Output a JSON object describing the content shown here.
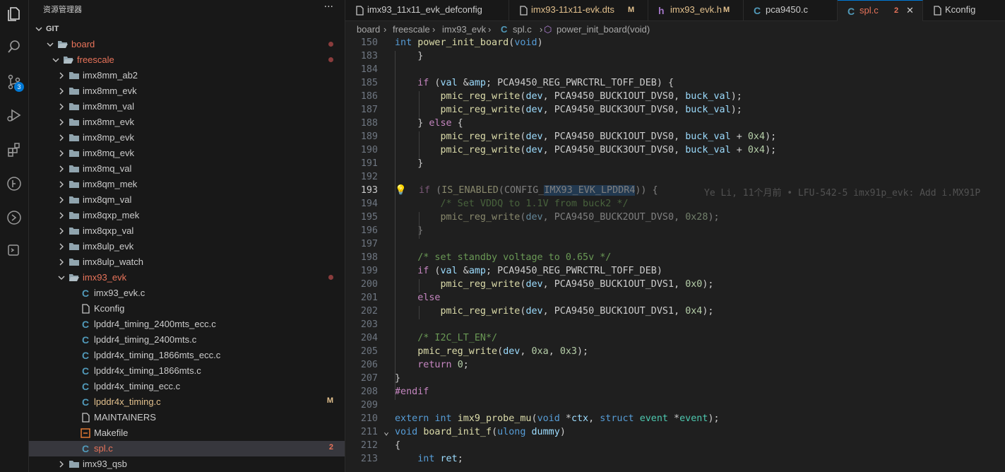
{
  "activity_bar": {
    "scm_badge": "3",
    "icons": [
      "explorer-icon",
      "search-icon",
      "source-control-icon",
      "run-debug-icon",
      "extensions-icon",
      "git-graph-icon",
      "remote-explorer-icon",
      "test-icon"
    ]
  },
  "sidebar": {
    "title": "资源管理器",
    "more": "···",
    "tree": [
      {
        "label": "GIT",
        "depth": 0,
        "kind": "root",
        "chevron": "down"
      },
      {
        "label": "board",
        "depth": 1,
        "kind": "folder",
        "chevron": "down",
        "status": "dot",
        "color": "#e8735a"
      },
      {
        "label": "freescale",
        "depth": 2,
        "kind": "folder",
        "chevron": "down",
        "status": "dot",
        "color": "#e8735a"
      },
      {
        "label": "imx8mm_ab2",
        "depth": 3,
        "kind": "folder",
        "chevron": "right"
      },
      {
        "label": "imx8mm_evk",
        "depth": 3,
        "kind": "folder",
        "chevron": "right"
      },
      {
        "label": "imx8mm_val",
        "depth": 3,
        "kind": "folder",
        "chevron": "right"
      },
      {
        "label": "imx8mn_evk",
        "depth": 3,
        "kind": "folder",
        "chevron": "right"
      },
      {
        "label": "imx8mp_evk",
        "depth": 3,
        "kind": "folder",
        "chevron": "right"
      },
      {
        "label": "imx8mq_evk",
        "depth": 3,
        "kind": "folder",
        "chevron": "right"
      },
      {
        "label": "imx8mq_val",
        "depth": 3,
        "kind": "folder",
        "chevron": "right"
      },
      {
        "label": "imx8qm_mek",
        "depth": 3,
        "kind": "folder",
        "chevron": "right"
      },
      {
        "label": "imx8qm_val",
        "depth": 3,
        "kind": "folder",
        "chevron": "right"
      },
      {
        "label": "imx8qxp_mek",
        "depth": 3,
        "kind": "folder",
        "chevron": "right"
      },
      {
        "label": "imx8qxp_val",
        "depth": 3,
        "kind": "folder",
        "chevron": "right"
      },
      {
        "label": "imx8ulp_evk",
        "depth": 3,
        "kind": "folder",
        "chevron": "right"
      },
      {
        "label": "imx8ulp_watch",
        "depth": 3,
        "kind": "folder",
        "chevron": "right"
      },
      {
        "label": "imx93_evk",
        "depth": 3,
        "kind": "folder",
        "chevron": "down",
        "status": "dot",
        "color": "#e8735a"
      },
      {
        "label": "imx93_evk.c",
        "depth": 4,
        "kind": "c"
      },
      {
        "label": "Kconfig",
        "depth": 4,
        "kind": "file"
      },
      {
        "label": "lpddr4_timing_2400mts_ecc.c",
        "depth": 4,
        "kind": "c"
      },
      {
        "label": "lpddr4_timing_2400mts.c",
        "depth": 4,
        "kind": "c"
      },
      {
        "label": "lpddr4x_timing_1866mts_ecc.c",
        "depth": 4,
        "kind": "c"
      },
      {
        "label": "lpddr4x_timing_1866mts.c",
        "depth": 4,
        "kind": "c"
      },
      {
        "label": "lpddr4x_timing_ecc.c",
        "depth": 4,
        "kind": "c"
      },
      {
        "label": "lpddr4x_timing.c",
        "depth": 4,
        "kind": "c",
        "status": "M",
        "color": "#e2c08d"
      },
      {
        "label": "MAINTAINERS",
        "depth": 4,
        "kind": "file"
      },
      {
        "label": "Makefile",
        "depth": 4,
        "kind": "make"
      },
      {
        "label": "spl.c",
        "depth": 4,
        "kind": "c",
        "status": "2",
        "color": "#e8735a",
        "selected": true
      },
      {
        "label": "imx93_qsb",
        "depth": 3,
        "kind": "folder",
        "chevron": "right"
      }
    ]
  },
  "tabs": [
    {
      "label": "imx93_11x11_evk_defconfig",
      "icon": "config-file-icon",
      "color": "#cccccc"
    },
    {
      "label": "imx93-11x11-evk.dts",
      "icon": "dts-file-icon",
      "status": "M",
      "color": "#e2c08d"
    },
    {
      "label": "imx93_evk.h",
      "icon": "h-file-icon",
      "status": "M",
      "color": "#e2c08d"
    },
    {
      "label": "pca9450.c",
      "icon": "c-file-icon",
      "color": "#cccccc"
    },
    {
      "label": "spl.c",
      "icon": "c-file-icon",
      "status": "2",
      "close": "✕",
      "color": "#e8735a",
      "active": true
    },
    {
      "label": "Kconfig",
      "icon": "config-file-icon",
      "color": "#cccccc"
    }
  ],
  "breadcrumbs": [
    "board",
    "freescale",
    "imx93_evk",
    "spl.c",
    "power_init_board(void)"
  ],
  "blame": "Ye Li, 11个月前 • LFU-542-5 imx91p_evk: Add i.MX91P",
  "code": [
    {
      "n": "150",
      "t": "int power_init_board(void)"
    },
    {
      "n": "183",
      "t": "    }"
    },
    {
      "n": "184",
      "t": ""
    },
    {
      "n": "185",
      "t": "    if (val & PCA9450_REG_PWRCTRL_TOFF_DEB) {"
    },
    {
      "n": "186",
      "t": "        pmic_reg_write(dev, PCA9450_BUCK1OUT_DVS0, buck_val);"
    },
    {
      "n": "187",
      "t": "        pmic_reg_write(dev, PCA9450_BUCK3OUT_DVS0, buck_val);"
    },
    {
      "n": "188",
      "t": "    } else {"
    },
    {
      "n": "189",
      "t": "        pmic_reg_write(dev, PCA9450_BUCK1OUT_DVS0, buck_val + 0x4);"
    },
    {
      "n": "190",
      "t": "        pmic_reg_write(dev, PCA9450_BUCK3OUT_DVS0, buck_val + 0x4);"
    },
    {
      "n": "191",
      "t": "    }"
    },
    {
      "n": "192",
      "t": ""
    },
    {
      "n": "193",
      "t": "    if (IS_ENABLED(CONFIG_IMX93_EVK_LPDDR4)) {"
    },
    {
      "n": "194",
      "t": "        /* Set VDDQ to 1.1V from buck2 */"
    },
    {
      "n": "195",
      "t": "        pmic_reg_write(dev, PCA9450_BUCK2OUT_DVS0, 0x28);"
    },
    {
      "n": "196",
      "t": "    }"
    },
    {
      "n": "197",
      "t": ""
    },
    {
      "n": "198",
      "t": "    /* set standby voltage to 0.65v */"
    },
    {
      "n": "199",
      "t": "    if (val & PCA9450_REG_PWRCTRL_TOFF_DEB)"
    },
    {
      "n": "200",
      "t": "        pmic_reg_write(dev, PCA9450_BUCK1OUT_DVS1, 0x0);"
    },
    {
      "n": "201",
      "t": "    else"
    },
    {
      "n": "202",
      "t": "        pmic_reg_write(dev, PCA9450_BUCK1OUT_DVS1, 0x4);"
    },
    {
      "n": "203",
      "t": ""
    },
    {
      "n": "204",
      "t": "    /* I2C_LT_EN*/"
    },
    {
      "n": "205",
      "t": "    pmic_reg_write(dev, 0xa, 0x3);"
    },
    {
      "n": "206",
      "t": "    return 0;"
    },
    {
      "n": "207",
      "t": "}"
    },
    {
      "n": "208",
      "t": "#endif"
    },
    {
      "n": "209",
      "t": ""
    },
    {
      "n": "210",
      "t": "extern int imx9_probe_mu(void *ctx, struct event *event);"
    },
    {
      "n": "211",
      "t": "void board_init_f(ulong dummy)"
    },
    {
      "n": "212",
      "t": "{"
    },
    {
      "n": "213",
      "t": "    int ret;"
    }
  ]
}
